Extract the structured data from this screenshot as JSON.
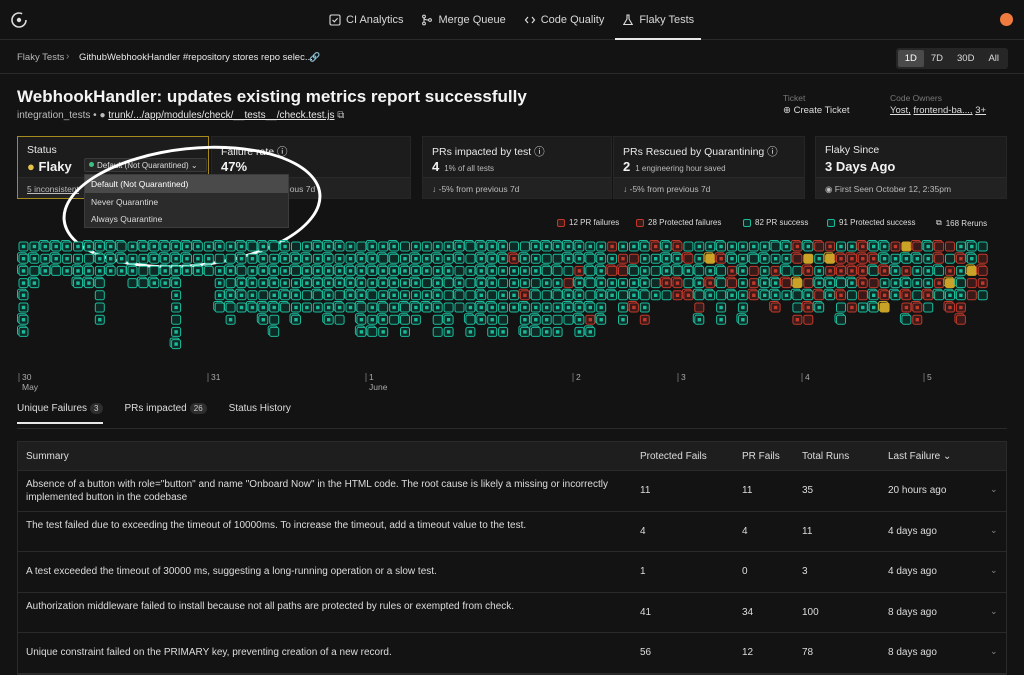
{
  "nav": {
    "items": [
      {
        "label": "CI Analytics",
        "icon": "checkbox-icon"
      },
      {
        "label": "Merge Queue",
        "icon": "merge-icon"
      },
      {
        "label": "Code Quality",
        "icon": "code-icon"
      },
      {
        "label": "Flaky Tests",
        "icon": "flask-icon",
        "active": true
      }
    ]
  },
  "breadcrumb": {
    "root": "Flaky Tests",
    "current": "GithubWebhookHandler #repository stores repo selec..."
  },
  "range": [
    "1D",
    "7D",
    "30D",
    "All"
  ],
  "range_selected": "1D",
  "header": {
    "title": "WebhookHandler: updates existing metrics report successfully",
    "suite": "integration_tests",
    "path": "trunk/.../app/modules/check/__tests__/check.test.js",
    "ticket_label": "Ticket",
    "ticket_action": "Create Ticket",
    "owners_label": "Code Owners",
    "owners": [
      "Yost,",
      "frontend-ba...,",
      "3+"
    ]
  },
  "cards": {
    "status": {
      "label": "Status",
      "value": "Flaky",
      "footer": "5 inconsistent"
    },
    "failure": {
      "label": "Failure rate",
      "value": "47%",
      "footer": "revious 7d"
    },
    "impacted": {
      "label": "PRs impacted by test",
      "value": "4",
      "note": "1% of all tests",
      "footer": "-5% from previous 7d"
    },
    "rescued": {
      "label": "PRs Rescued by Quarantining",
      "value": "2",
      "note": "1 engineering hour saved",
      "footer": "-5% from previous 7d"
    },
    "since": {
      "label": "Flaky Since",
      "value": "3 Days Ago",
      "footer": "First Seen October 12, 2:35pm"
    }
  },
  "quarantine_dropdown": {
    "selected": "Default (Not Quarantined)",
    "options": [
      "Default (Not Quarantined)",
      "Never Quarantine",
      "Always Quarantine"
    ]
  },
  "legend": [
    {
      "label": "12 PR failures",
      "color": "#c0392b"
    },
    {
      "label": "28 Protected failures",
      "color": "#c0392b"
    },
    {
      "label": "82 PR success",
      "color": "#1abc9c"
    },
    {
      "label": "91 Protected success",
      "color": "#1abc9c"
    },
    {
      "label": "168 Reruns",
      "color": "#888888"
    }
  ],
  "timeline": {
    "day_labels": [
      {
        "label": "30",
        "sub": "May"
      },
      {
        "label": "31",
        "sub": ""
      },
      {
        "label": "1",
        "sub": "June"
      },
      {
        "label": "2",
        "sub": ""
      },
      {
        "label": "3",
        "sub": ""
      },
      {
        "label": "4",
        "sub": ""
      },
      {
        "label": "5",
        "sub": ""
      }
    ]
  },
  "tabs": [
    {
      "label": "Unique Failures",
      "count": "3",
      "active": true
    },
    {
      "label": "PRs impacted",
      "count": "26"
    },
    {
      "label": "Status History",
      "count": ""
    }
  ],
  "table": {
    "headers": [
      "Summary",
      "Protected Fails",
      "PR Fails",
      "Total Runs",
      "Last Failure"
    ],
    "rows": [
      {
        "summary": "Absence of a button with role=\"button\" and name \"Onboard Now\" in the HTML code. The root cause is likely a missing or incorrectly implemented button in the codebase",
        "protected": "11",
        "pr": "11",
        "total": "35",
        "last": "20 hours ago"
      },
      {
        "summary": "The test failed due to exceeding the timeout of 10000ms. To increase the timeout, add a timeout value to the test.",
        "protected": "4",
        "pr": "4",
        "total": "11",
        "last": "4 days ago"
      },
      {
        "summary": "A test exceeded the timeout of 30000 ms, suggesting a long-running operation or a slow test.",
        "protected": "1",
        "pr": "0",
        "total": "3",
        "last": "4 days ago"
      },
      {
        "summary": "Authorization middleware failed to install because not all paths are protected by rules or exempted from check.",
        "protected": "41",
        "pr": "34",
        "total": "100",
        "last": "8 days ago"
      },
      {
        "summary": "Unique constraint failed on the PRIMARY key, preventing creation of a new record.",
        "protected": "56",
        "pr": "12",
        "total": "78",
        "last": "8 days ago"
      }
    ]
  }
}
